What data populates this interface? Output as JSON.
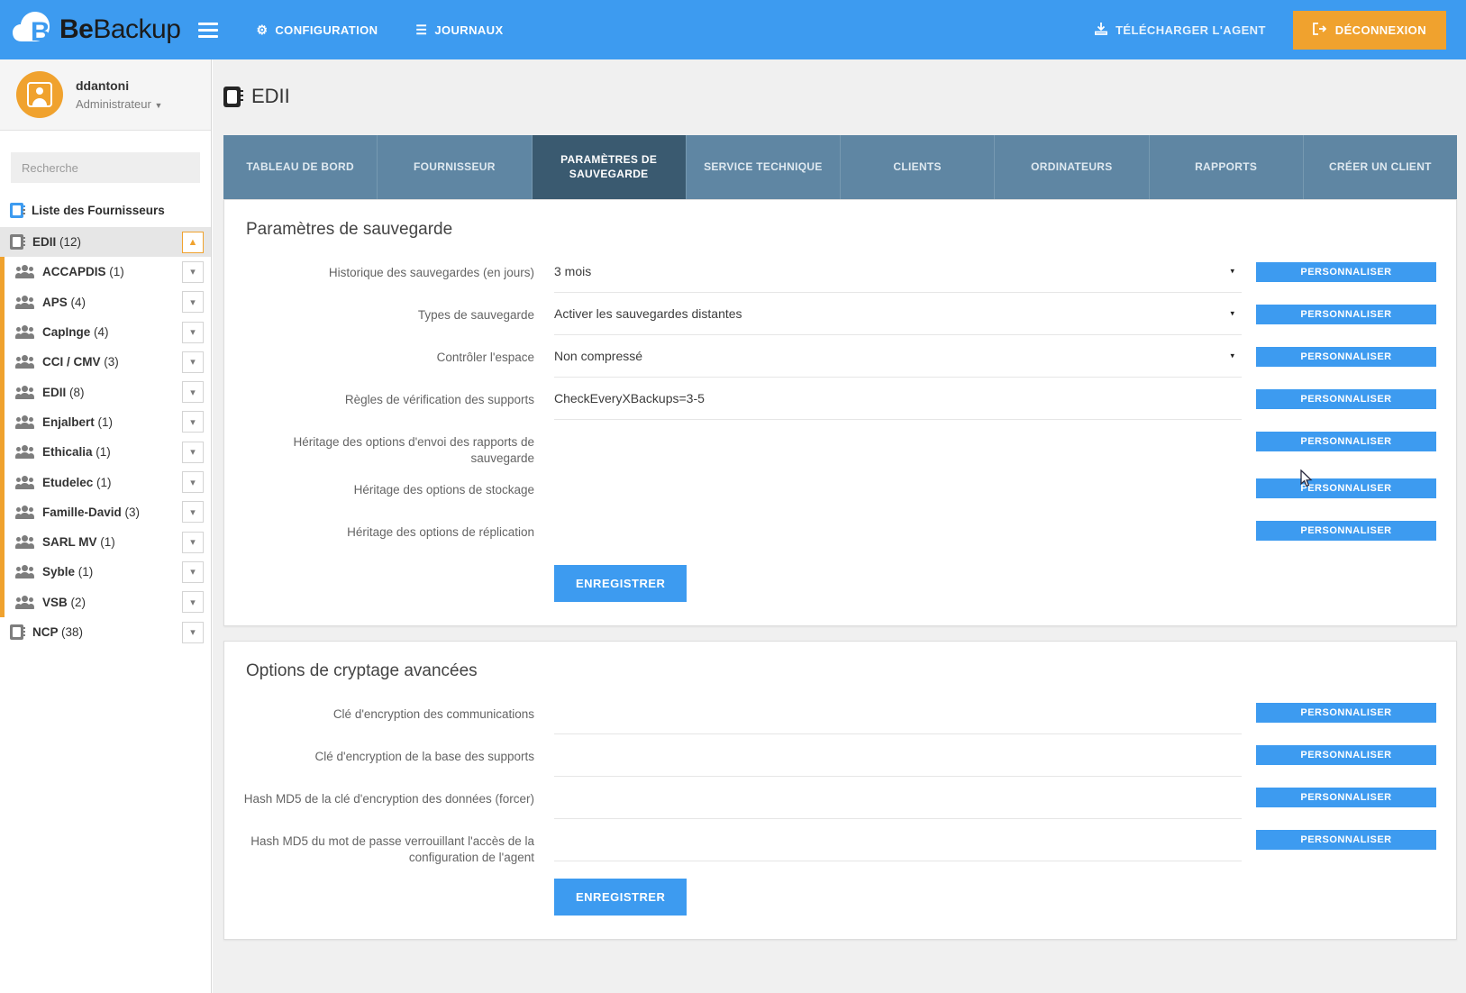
{
  "topnav": {
    "brand_be": "Be",
    "brand_backup": "Backup",
    "menu_icon": "hamburger-icon",
    "links": [
      {
        "label": "CONFIGURATION",
        "icon": "gears-icon"
      },
      {
        "label": "JOURNAUX",
        "icon": "list-icon"
      }
    ],
    "download_agent": "TÉLÉCHARGER L'AGENT",
    "logout": "DÉCONNEXION",
    "accent_color": "#3d9bf0",
    "logout_color": "#f0a22e"
  },
  "sidebar": {
    "user": {
      "name": "ddantoni",
      "role": "Administrateur"
    },
    "search": {
      "placeholder": "Recherche",
      "value": ""
    },
    "list_header": "Liste des Fournisseurs",
    "items": [
      {
        "label": "EDII",
        "count": "(12)",
        "icon": "contact-book-icon",
        "level": "root",
        "expanded": true,
        "toggle": "chevron-up-icon"
      },
      {
        "label": "ACCAPDIS",
        "count": "(1)",
        "icon": "users-icon",
        "level": "child",
        "expanded": false,
        "toggle": "chevron-down-icon"
      },
      {
        "label": "APS",
        "count": "(4)",
        "icon": "users-icon",
        "level": "child",
        "expanded": false,
        "toggle": "chevron-down-icon"
      },
      {
        "label": "CapInge",
        "count": "(4)",
        "icon": "users-icon",
        "level": "child",
        "expanded": false,
        "toggle": "chevron-down-icon"
      },
      {
        "label": "CCI / CMV",
        "count": "(3)",
        "icon": "users-icon",
        "level": "child",
        "expanded": false,
        "toggle": "chevron-down-icon"
      },
      {
        "label": "EDII",
        "count": "(8)",
        "icon": "users-icon",
        "level": "child",
        "expanded": false,
        "toggle": "chevron-down-icon"
      },
      {
        "label": "Enjalbert",
        "count": "(1)",
        "icon": "users-icon",
        "level": "child",
        "expanded": false,
        "toggle": "chevron-down-icon"
      },
      {
        "label": "Ethicalia",
        "count": "(1)",
        "icon": "users-icon",
        "level": "child",
        "expanded": false,
        "toggle": "chevron-down-icon"
      },
      {
        "label": "Etudelec",
        "count": "(1)",
        "icon": "users-icon",
        "level": "child",
        "expanded": false,
        "toggle": "chevron-down-icon"
      },
      {
        "label": "Famille-David",
        "count": "(3)",
        "icon": "users-icon",
        "level": "child",
        "expanded": false,
        "toggle": "chevron-down-icon"
      },
      {
        "label": "SARL MV",
        "count": "(1)",
        "icon": "users-icon",
        "level": "child",
        "expanded": false,
        "toggle": "chevron-down-icon"
      },
      {
        "label": "Syble",
        "count": "(1)",
        "icon": "users-icon",
        "level": "child",
        "expanded": false,
        "toggle": "chevron-down-icon"
      },
      {
        "label": "VSB",
        "count": "(2)",
        "icon": "users-icon",
        "level": "child",
        "expanded": false,
        "toggle": "chevron-down-icon"
      },
      {
        "label": "NCP",
        "count": "(38)",
        "icon": "contact-book-icon",
        "level": "root2",
        "expanded": false,
        "toggle": "chevron-down-icon"
      }
    ]
  },
  "main": {
    "page_title": "EDII",
    "page_title_icon": "contact-book-icon",
    "tabs": [
      {
        "label": "TABLEAU DE BORD",
        "active": false
      },
      {
        "label": "FOURNISSEUR",
        "active": false
      },
      {
        "label": "PARAMÈTRES DE SAUVEGARDE",
        "active": true
      },
      {
        "label": "SERVICE TECHNIQUE",
        "active": false
      },
      {
        "label": "CLIENTS",
        "active": false
      },
      {
        "label": "ORDINATEURS",
        "active": false
      },
      {
        "label": "RAPPORTS",
        "active": false
      },
      {
        "label": "CRÉER UN CLIENT",
        "active": false
      }
    ],
    "customize_label": "PERSONNALISER",
    "save_label": "ENREGISTRER",
    "cards": [
      {
        "title": "Paramètres de sauvegarde",
        "rows": [
          {
            "label": "Historique des sauvegardes (en jours)",
            "value": "3 mois",
            "type": "select",
            "underline": true
          },
          {
            "label": "Types de sauvegarde",
            "value": "Activer les sauvegardes distantes",
            "type": "select",
            "underline": true
          },
          {
            "label": "Contrôler l'espace",
            "value": "Non compressé",
            "type": "select",
            "underline": true
          },
          {
            "label": "Règles de vérification des supports",
            "value": "CheckEveryXBackups=3-5",
            "type": "text",
            "underline": true
          },
          {
            "label": "Héritage des options d'envoi des rapports de sauvegarde",
            "value": "",
            "type": "none",
            "underline": false
          },
          {
            "label": "Héritage des options de stockage",
            "value": "",
            "type": "none",
            "underline": false
          },
          {
            "label": "Héritage des options de réplication",
            "value": "",
            "type": "none",
            "underline": false
          }
        ]
      },
      {
        "title": "Options de cryptage avancées",
        "rows": [
          {
            "label": "Clé d'encryption des communications",
            "value": "",
            "type": "text",
            "underline": true
          },
          {
            "label": "Clé d'encryption de la base des supports",
            "value": "",
            "type": "text",
            "underline": true
          },
          {
            "label": "Hash MD5 de la clé d'encryption des données (forcer)",
            "value": "",
            "type": "text",
            "underline": true
          },
          {
            "label": "Hash MD5 du mot de passe verrouillant l'accès de la configuration de l'agent",
            "value": "",
            "type": "text",
            "underline": true
          }
        ]
      }
    ]
  }
}
